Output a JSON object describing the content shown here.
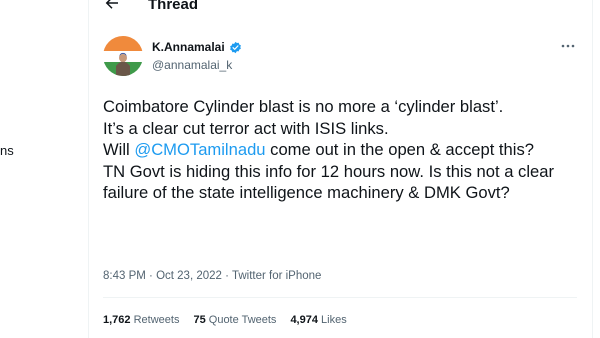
{
  "sidebar": {
    "fragment": "ns"
  },
  "header": {
    "title": "Thread"
  },
  "tweet": {
    "author": {
      "name": "K.Annamalai",
      "handle": "@annamalai_k"
    },
    "text": {
      "line1": "Coimbatore Cylinder blast is no more a ‘cylinder blast’.",
      "line2": "It’s a clear cut terror act with ISIS links.",
      "line3_before": "Will ",
      "mention": "@CMOTamilnadu",
      "line3_after": " come out in the open & accept this?",
      "line4": "TN Govt is hiding this info for 12 hours now. Is this not a clear failure of the state intelligence machinery & DMK Govt?"
    },
    "time": "8:43 PM",
    "separator1": " · ",
    "date": "Oct 23, 2022",
    "separator2": " · ",
    "source": "Twitter for iPhone",
    "stats": {
      "retweets_count": "1,762",
      "retweets_label": "Retweets",
      "quotes_count": "75",
      "quotes_label": "Quote Tweets",
      "likes_count": "4,974",
      "likes_label": "Likes"
    }
  },
  "colors": {
    "accent": "#1d9bf0",
    "text": "#0f1419",
    "secondary": "#536471",
    "divider": "#eff3f4"
  },
  "icons": [
    "back-arrow-icon",
    "verified-badge-icon",
    "more-options-icon"
  ]
}
